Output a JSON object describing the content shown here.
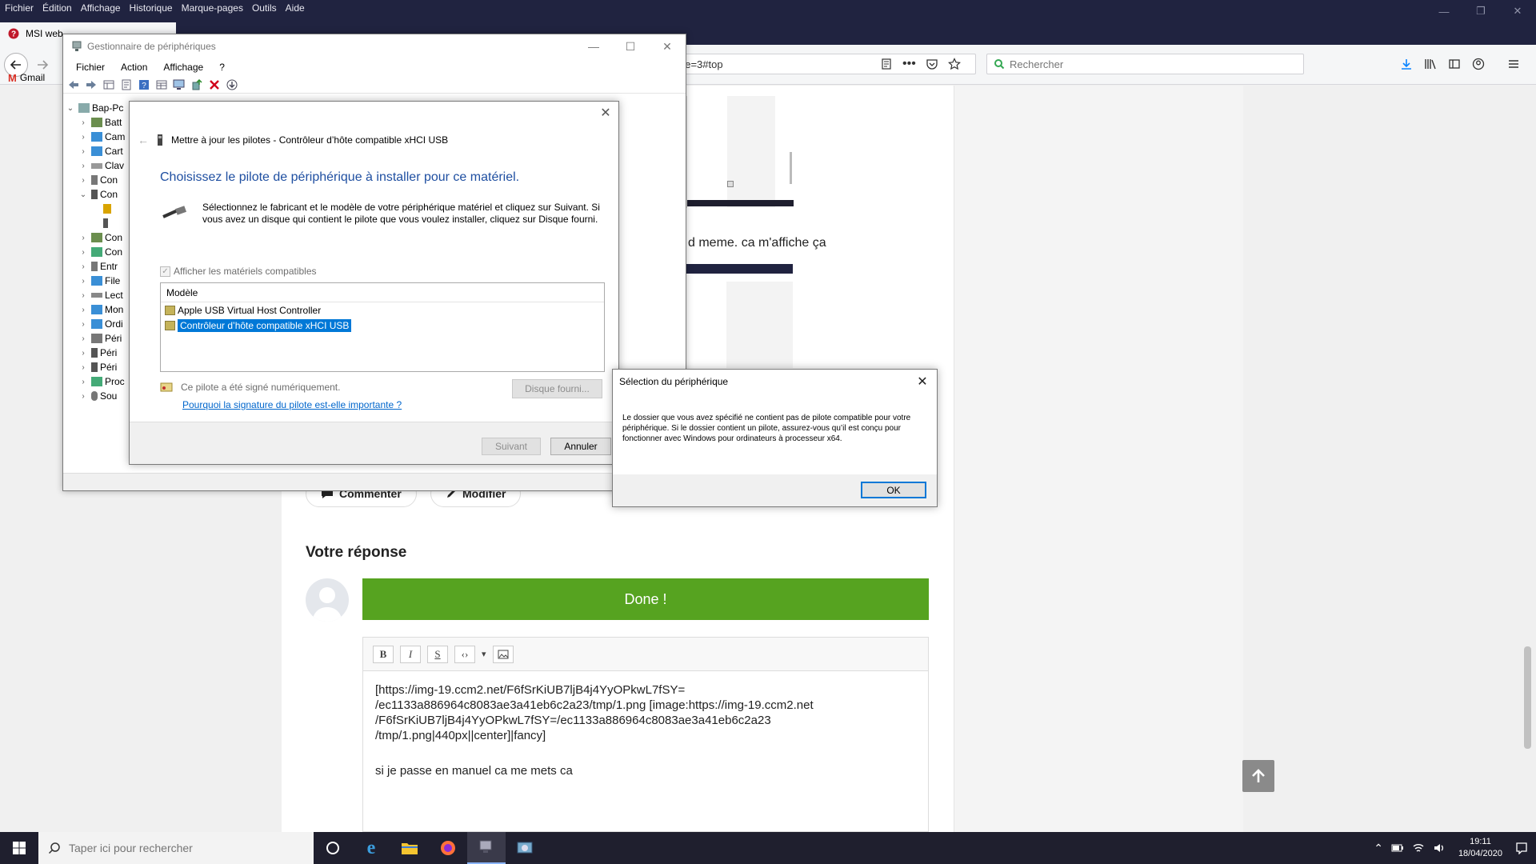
{
  "firefox": {
    "menu": [
      "Fichier",
      "Édition",
      "Affichage",
      "Historique",
      "Marque-pages",
      "Outils",
      "Aide"
    ],
    "tab_title": "MSI web",
    "url_fragment": "ge=3#top",
    "search_placeholder": "Rechercher",
    "bookmark_gmail": "Gmail"
  },
  "page": {
    "post_text": "d meme. ca m'affiche ça",
    "comment_label": "Commenter",
    "edit_label": "Modifier",
    "reply_title": "Votre réponse",
    "done_label": "Done !",
    "editor_toolbar": [
      "B",
      "I",
      "S",
      "‹›",
      "▾"
    ],
    "editor_content": "[https://img-19.ccm2.net/F6fSrKiUB7ljB4j4YyOPkwL7fSY=\n/ec1133a886964c8083ae3a41eb6c2a23/tmp/1.png [image:https://img-19.ccm2.net\n/F6fSrKiUB7ljB4j4YyOPkwL7fSY=/ec1133a886964c8083ae3a41eb6c2a23\n/tmp/1.png|440px||center]|fancy]",
    "editor_line2": "si je passe en manuel ca me mets ca"
  },
  "device_manager": {
    "title": "Gestionnaire de périphériques",
    "menu": [
      "Fichier",
      "Action",
      "Affichage",
      "?"
    ],
    "tree": [
      {
        "label": "Bap-Pc",
        "expanded": true,
        "level": 0
      },
      {
        "label": "Batt",
        "level": 1
      },
      {
        "label": "Cam",
        "level": 1
      },
      {
        "label": "Cart",
        "level": 1
      },
      {
        "label": "Clav",
        "level": 1
      },
      {
        "label": "Con",
        "level": 1
      },
      {
        "label": "Con",
        "level": 1,
        "expanded": true
      },
      {
        "label": "",
        "level": 2
      },
      {
        "label": "",
        "level": 2
      },
      {
        "label": "Con",
        "level": 1
      },
      {
        "label": "Con",
        "level": 1
      },
      {
        "label": "Entr",
        "level": 1
      },
      {
        "label": "File",
        "level": 1
      },
      {
        "label": "Lect",
        "level": 1
      },
      {
        "label": "Mon",
        "level": 1
      },
      {
        "label": "Ordi",
        "level": 1
      },
      {
        "label": "Péri",
        "level": 1
      },
      {
        "label": "Péri",
        "level": 1
      },
      {
        "label": "Péri",
        "level": 1
      },
      {
        "label": "Proc",
        "level": 1
      },
      {
        "label": "Sou",
        "level": 1
      }
    ]
  },
  "update_dialog": {
    "header": "Mettre à jour les pilotes - Contrôleur d’hôte compatible xHCI USB",
    "heading": "Choisissez le pilote de périphérique à installer pour ce matériel.",
    "description": "Sélectionnez le fabricant et le modèle de votre périphérique matériel et cliquez sur Suivant. Si vous avez un disque qui contient le pilote que vous voulez installer, cliquez sur Disque fourni.",
    "show_compatible": "Afficher les matériels compatibles",
    "list_header": "Modèle",
    "models": [
      "Apple USB Virtual Host Controller",
      "Contrôleur d’hôte compatible xHCI USB"
    ],
    "signed_text": "Ce pilote a été signé numériquement.",
    "signature_link": "Pourquoi la signature du pilote est-elle importante ?",
    "disk_button": "Disque fourni...",
    "next_button": "Suivant",
    "cancel_button": "Annuler"
  },
  "selection_dialog": {
    "title": "Sélection du périphérique",
    "message": "Le dossier que vous avez spécifié ne contient pas de pilote compatible pour votre périphérique. Si le dossier contient un pilote, assurez-vous qu’il est conçu pour fonctionner avec Windows pour ordinateurs à processeur x64.",
    "ok_button": "OK"
  },
  "taskbar": {
    "search_placeholder": "Taper ici pour rechercher",
    "time": "19:11",
    "date": "18/04/2020"
  },
  "colors": {
    "titlebar": "#202340",
    "accent_green": "#56a320",
    "win_blue": "#0078d7",
    "heading_blue": "#1f4fa1"
  }
}
